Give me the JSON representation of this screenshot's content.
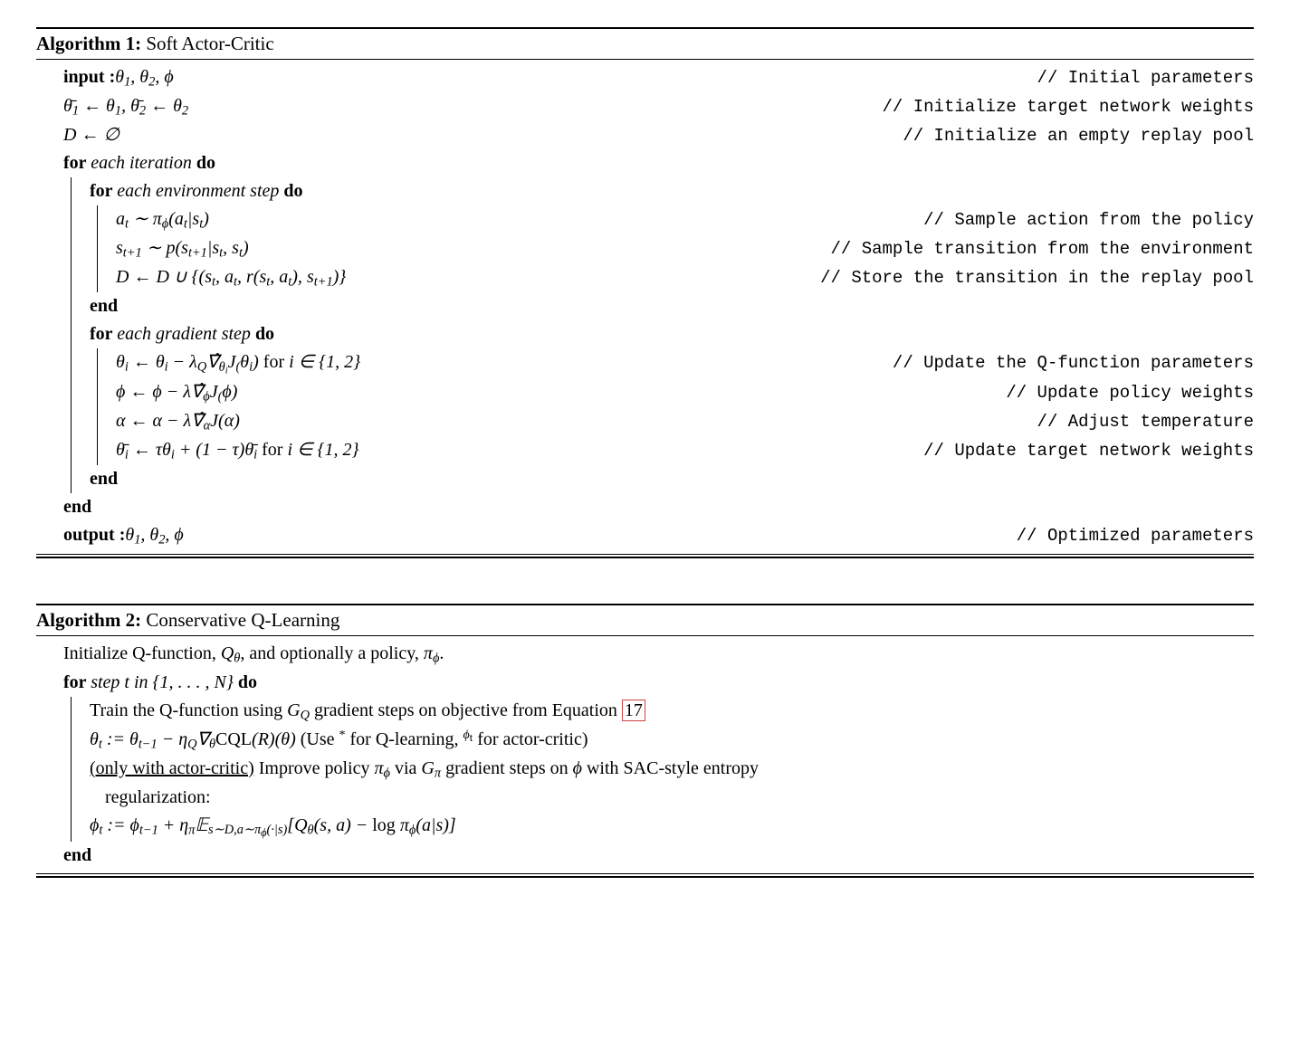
{
  "algo1": {
    "number": "Algorithm 1:",
    "title": " Soft Actor-Critic",
    "input_kw": "input  :",
    "input_vars": " θ₁, θ₂, ϕ",
    "input_comment": "// Initial parameters",
    "line2_lhs": "θ̄₁ ← θ₁, θ̄₂ ← θ₂",
    "line2_comment": "// Initialize target network weights",
    "line3_lhs": "𝒟 ← ∅",
    "line3_comment": "// Initialize an empty replay pool",
    "for_outer": "for ",
    "for_outer_cond": "each iteration",
    "do": " do",
    "for_env": "for ",
    "for_env_cond": "each environment step",
    "env1_lhs": "aₜ ∼ π_ϕ(aₜ|sₜ)",
    "env1_comment": "// Sample action from the policy",
    "env2_lhs": "sₜ₊₁ ∼ p(sₜ₊₁|sₜ, sₜ)",
    "env2_comment": "// Sample transition from the environment",
    "env3_lhs": "𝒟 ← 𝒟 ∪ {(sₜ, aₜ, r(sₜ, aₜ), sₜ₊₁)}",
    "env3_comment": "// Store the transition in the replay pool",
    "end": "end",
    "for_grad": "for ",
    "for_grad_cond": "each gradient step",
    "grad1_lhs": "θᵢ ← θᵢ − λ_Q ∇̂_θᵢ J_(θᵢ) for i ∈ {1, 2}",
    "grad1_comment": "// Update the Q-function parameters",
    "grad2_lhs": "ϕ ← ϕ − λ ∇̂_ϕ J_(ϕ)",
    "grad2_comment": "// Update policy weights",
    "grad3_lhs": "α ← α − λ ∇̂_α J(α)",
    "grad3_comment": "// Adjust temperature",
    "grad4_lhs": "θ̄ᵢ ← τθᵢ + (1 − τ)θ̄ᵢ for i ∈ {1, 2}",
    "grad4_comment": "// Update target network weights",
    "output_kw": "output :",
    "output_vars": " θ₁, θ₂, ϕ",
    "output_comment": "// Optimized parameters"
  },
  "algo2": {
    "number": "Algorithm 2:",
    "title": " Conservative Q-Learning",
    "line1": "Initialize Q-function, Q_θ, and optionally a policy, π_ϕ.",
    "for_kw": "for ",
    "for_cond": "step t in {1, . . . , N}",
    "do": " do",
    "body1_a": "Train the Q-function using ",
    "body1_b": "G_Q",
    "body1_c": " gradient steps on objective from Equation ",
    "body1_ref": "17",
    "body2": "θₜ := θₜ₋₁ − η_Q ∇_θ CQL(ℛ)(θ) (Use * for Q-learning, ϕₜ for actor-critic)",
    "body3_a": "(only with actor-critic)",
    "body3_b": " Improve policy π_ϕ via G_π gradient steps on ϕ with SAC-style entropy",
    "body3_c": " regularization:",
    "body4": "ϕₜ := ϕₜ₋₁ + η_π 𝔼_{s∼𝒟, a∼π_ϕ(·|s)}[Q_θ(s, a) − log π_ϕ(a|s)]",
    "end": "end"
  }
}
